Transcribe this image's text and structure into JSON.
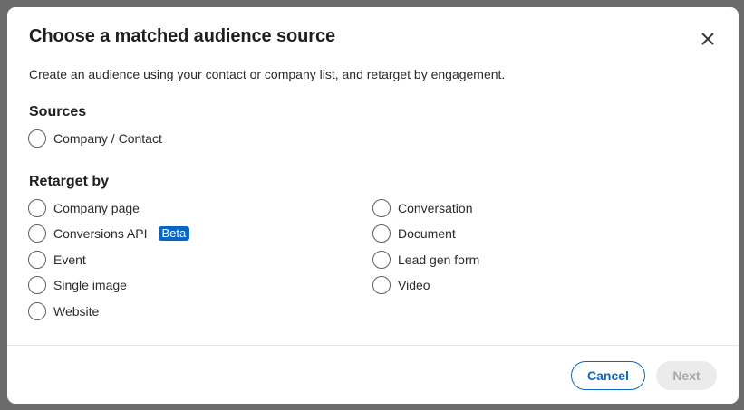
{
  "dialog": {
    "title": "Choose a matched audience source",
    "description": "Create an audience using your contact or company list, and retarget by engagement."
  },
  "sources": {
    "heading": "Sources",
    "options": [
      {
        "label": "Company / Contact",
        "selected": false
      }
    ]
  },
  "retarget": {
    "heading": "Retarget by",
    "left_column": [
      {
        "label": "Company page",
        "selected": false
      },
      {
        "label": "Conversions API",
        "badge": "Beta",
        "selected": false
      },
      {
        "label": "Event",
        "selected": false
      },
      {
        "label": "Single image",
        "selected": false
      },
      {
        "label": "Website",
        "selected": false
      }
    ],
    "right_column": [
      {
        "label": "Conversation",
        "selected": false
      },
      {
        "label": "Document",
        "selected": false
      },
      {
        "label": "Lead gen form",
        "selected": false
      },
      {
        "label": "Video",
        "selected": false
      }
    ]
  },
  "footer": {
    "cancel_label": "Cancel",
    "next_label": "Next",
    "next_enabled": false
  },
  "colors": {
    "accent": "#0a66c2",
    "badge_bg": "#0a66c2",
    "disabled_bg": "#ebebeb",
    "disabled_text": "#a8a8a8"
  },
  "icons": {
    "close": "close-icon"
  }
}
